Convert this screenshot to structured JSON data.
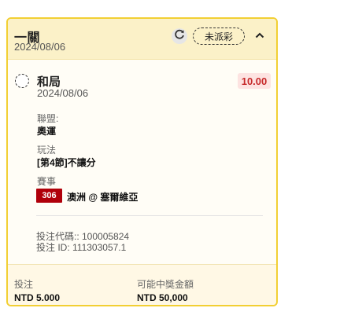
{
  "card": {
    "title": "一關",
    "date": "2024/08/06",
    "status": "未派彩"
  },
  "bet": {
    "result": "和局",
    "date": "2024/08/06",
    "odds": "10.00",
    "league_label": "聯盟:",
    "league": "奧運",
    "play_label": "玩法",
    "play": "[第4節]不讓分",
    "event_label": "賽事",
    "match_id": "306",
    "match": "澳洲 @ 塞爾維亞",
    "bet_code": "投注代碼:: 100005824",
    "bet_id": "投注 ID: 111303057.1"
  },
  "footer": {
    "stake_label": "投注",
    "stake_value": "NTD 5.000",
    "payout_label": "可能中獎金額",
    "payout_value": "NTD 50,000"
  },
  "colors": {
    "card_border": "#f2cf33",
    "header_bg": "#fbf1c8",
    "odds_text": "#c62828",
    "odds_bg": "#fde3e1",
    "match_tag_bg": "#b0000a"
  },
  "icons": {
    "refresh": "refresh-icon",
    "collapse": "chevron-up-icon",
    "result": "dashed-circle-icon"
  }
}
